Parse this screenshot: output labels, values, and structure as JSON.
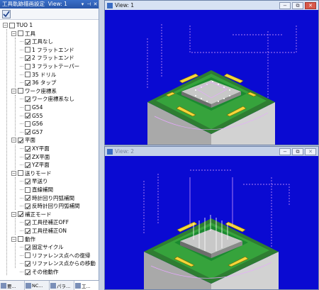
{
  "panel": {
    "title": "工具軌跡描画設定",
    "view_indicator": "View: 1",
    "pin_label": "⊣",
    "close_label": "✕"
  },
  "tree": [
    {
      "label": "TUO 1",
      "checked": false,
      "expander": "−"
    },
    {
      "label": "工具",
      "checked": false,
      "expander": "−"
    },
    {
      "label": "工具なし",
      "checked": true
    },
    {
      "label": "1 フラットエンド",
      "checked": false
    },
    {
      "label": "2 フラットエンド",
      "checked": true
    },
    {
      "label": "3 フラットテーパー",
      "checked": false
    },
    {
      "label": "35 ドリル",
      "checked": false
    },
    {
      "label": "36 タップ",
      "checked": true
    },
    {
      "label": "ワーク座標系",
      "checked": false,
      "expander": "−"
    },
    {
      "label": "ワーク座標系なし",
      "checked": true
    },
    {
      "label": "G54",
      "checked": false
    },
    {
      "label": "G55",
      "checked": true
    },
    {
      "label": "G56",
      "checked": false
    },
    {
      "label": "G57",
      "checked": true
    },
    {
      "label": "平面",
      "checked": true,
      "expander": "−"
    },
    {
      "label": "XY平面",
      "checked": true
    },
    {
      "label": "ZX平面",
      "checked": true
    },
    {
      "label": "YZ平面",
      "checked": true
    },
    {
      "label": "送りモード",
      "checked": false,
      "expander": "−"
    },
    {
      "label": "早送り",
      "checked": true
    },
    {
      "label": "直線補間",
      "checked": false
    },
    {
      "label": "時計回り円弧補間",
      "checked": true
    },
    {
      "label": "反時計回り円弧補間",
      "checked": true
    },
    {
      "label": "補正モード",
      "checked": true,
      "expander": "−"
    },
    {
      "label": "工具径補正OFF",
      "checked": true
    },
    {
      "label": "工具径補正ON",
      "checked": true
    },
    {
      "label": "動作",
      "checked": false,
      "expander": "−"
    },
    {
      "label": "固定サイクル",
      "checked": true
    },
    {
      "label": "リファレンス点への復帰",
      "checked": false
    },
    {
      "label": "リファレンス点からの移動",
      "checked": true
    },
    {
      "label": "その他動作",
      "checked": true
    }
  ],
  "bottom_tabs": [
    {
      "label": "要..."
    },
    {
      "label": "NC..."
    },
    {
      "label": "パラ..."
    },
    {
      "label": "工..."
    }
  ],
  "views": [
    {
      "title": "View: 1",
      "minimize": "−",
      "restore": "⧉",
      "close": "✕"
    },
    {
      "title": "View: 2",
      "minimize": "−",
      "restore": "⧉",
      "close": "✕"
    }
  ],
  "colors": {
    "viewport_bg": "#0a0ad2",
    "toolpath": "#e7a8ff",
    "part_top": "#2e7d32",
    "highlight_yellow": "#f5d63a"
  }
}
